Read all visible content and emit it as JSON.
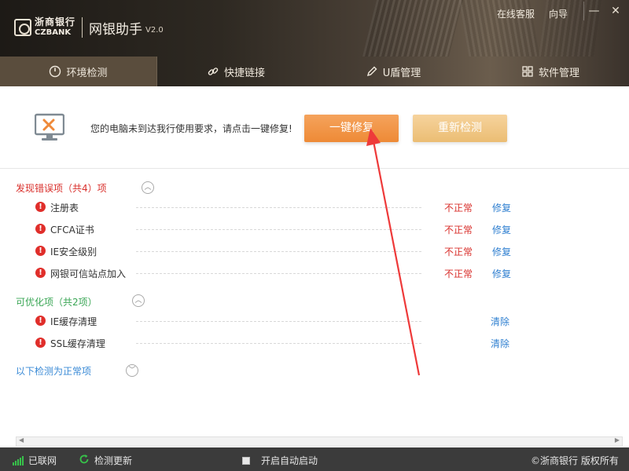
{
  "window": {
    "logo_cn": "浙商银行",
    "logo_en": "CZBANK",
    "title": "网银助手",
    "version": "V2.0",
    "top_links": [
      "在线客服",
      "向导"
    ],
    "min_glyph": "—",
    "close_glyph": "✕"
  },
  "tabs": [
    {
      "label": "环境检测",
      "icon": "gauge-icon",
      "active": true
    },
    {
      "label": "快捷链接",
      "icon": "link-icon",
      "active": false
    },
    {
      "label": "U盾管理",
      "icon": "pen-icon",
      "active": false
    },
    {
      "label": "软件管理",
      "icon": "grid-icon",
      "active": false
    }
  ],
  "action": {
    "message": "您的电脑未到达我行使用要求，请点击一键修复!",
    "fix_button": "一键修复",
    "recheck_button": "重新检测"
  },
  "sections": {
    "errors": {
      "title": "发现错误项（共4）项",
      "items": [
        {
          "name": "注册表",
          "status": "不正常",
          "action": "修复"
        },
        {
          "name": "CFCA证书",
          "status": "不正常",
          "action": "修复"
        },
        {
          "name": "IE安全级别",
          "status": "不正常",
          "action": "修复"
        },
        {
          "name": "网银可信站点加入",
          "status": "不正常",
          "action": "修复"
        }
      ]
    },
    "optimizable": {
      "title": "可优化项（共2项）",
      "items": [
        {
          "name": "IE缓存清理",
          "action": "清除"
        },
        {
          "name": "SSL缓存清理",
          "action": "清除"
        }
      ]
    },
    "normal": {
      "title": "以下检测为正常项"
    }
  },
  "statusbar": {
    "network": "已联网",
    "update": "检测更新",
    "autostart": "开启自动启动",
    "copyright": "©浙商银行 版权所有"
  },
  "colors": {
    "error": "#d9302c",
    "optimizable": "#3aa655",
    "normal": "#3a8ad6",
    "fix_button": "#ee8a36",
    "recheck_button": "#ebbd73"
  }
}
